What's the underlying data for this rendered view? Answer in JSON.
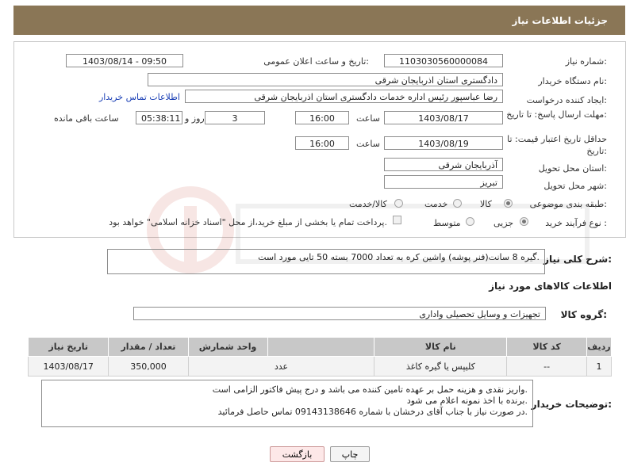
{
  "header": {
    "title": "جزئیات اطلاعات نیاز"
  },
  "form": {
    "need_number": {
      "label": "شماره نیاز:",
      "value": "1103030560000084"
    },
    "announce_datetime": {
      "label": "تاریخ و ساعت اعلان عمومی:",
      "value": "1403/08/14 - 09:50"
    },
    "buyer_org": {
      "label": "نام دستگاه خریدار:",
      "value": "دادگستری استان اذربایجان شرقی"
    },
    "requester": {
      "label": "ایجاد کننده درخواست:",
      "value": "رضا عباسپور رئیس اداره خدمات دادگستری استان اذربایجان شرقی",
      "contact_link": "اطلاعات تماس خریدار"
    },
    "reply_deadline": {
      "label": "مهلت ارسال پاسخ: تا تاریخ:",
      "date": "1403/08/17",
      "time_label": "ساعت",
      "time": "16:00",
      "days": "3",
      "days_label": "روز و",
      "remaining": "05:38:11",
      "remaining_label": "ساعت باقی مانده"
    },
    "price_validity": {
      "label": "حداقل تاریخ اعتبار قیمت: تا تاریخ:",
      "date": "1403/08/19",
      "time_label": "ساعت",
      "time": "16:00"
    },
    "delivery_province": {
      "label": "استان محل تحویل:",
      "value": "آذربایجان شرقی"
    },
    "delivery_city": {
      "label": "شهر محل تحویل:",
      "value": "تبریز"
    },
    "category": {
      "label": "طبقه بندی موضوعی:",
      "options": [
        "کالا",
        "خدمت",
        "کالا/خدمت"
      ],
      "selected": "کالا"
    },
    "purchase_process": {
      "label": "نوع فرآیند خرید :",
      "options": [
        "جزیی",
        "متوسط"
      ],
      "selected": "جزیی",
      "note": "پرداخت تمام یا بخشی از مبلغ خرید،از محل \"اسناد خزانه اسلامی\" خواهد بود."
    }
  },
  "description": {
    "label": "شرح کلی نیاز:",
    "value": "گیره 8 سانت(فنر پوشه) واشین کره به تعداد 7000 بسته 50 تایی مورد است."
  },
  "goods_info": {
    "title": "اطلاعات کالاهای مورد نیاز",
    "group_label": "گروه کالا:",
    "group_value": "تجهیزات و وسایل تحصیلی واداری"
  },
  "table": {
    "headers": [
      "ردیف",
      "کد کالا",
      "نام کالا",
      "واحد شمارش",
      "تعداد / مقدار",
      "تاریخ نیاز"
    ],
    "rows": [
      [
        "1",
        "--",
        "کلیپس یا گیره کاغذ",
        "عدد",
        "350,000",
        "1403/08/17"
      ]
    ]
  },
  "buyer_notes": {
    "label": "توضیحات خریدار:",
    "lines": [
      "واریز نقدی و هزینه حمل بر عهده تامین کننده می باشد و درج پیش فاکتور الزامی است.",
      "برنده با اخذ نمونه اعلام می شود.",
      "در صورت نیاز با جناب آقای درخشان با شماره 09143138646 تماس حاصل فرمائید."
    ]
  },
  "buttons": {
    "print": "چاپ",
    "back": "بازگشت"
  },
  "colors": {
    "title_bg": "#8a7656",
    "link": "#1a3fb5"
  }
}
